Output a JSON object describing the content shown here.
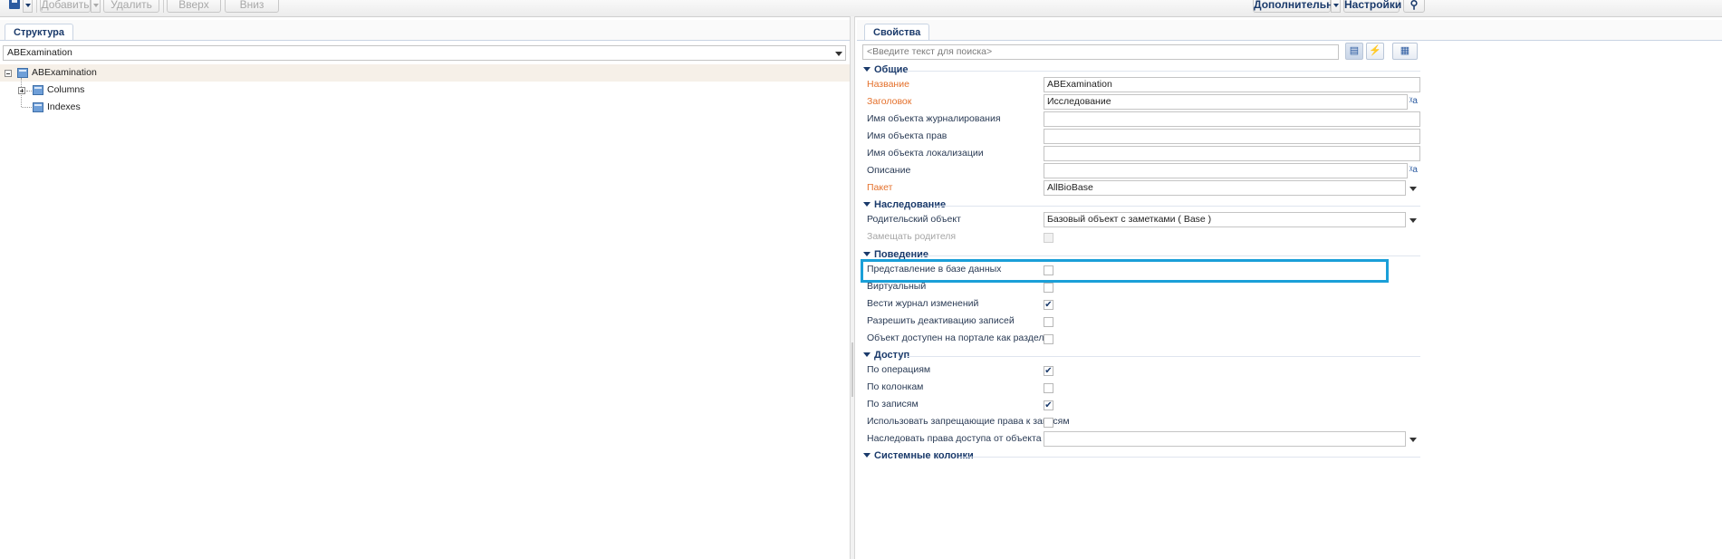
{
  "toolbar": {
    "add_label": "Добавить",
    "delete_label": "Удалить",
    "up_label": "Вверх",
    "down_label": "Вниз",
    "additional_label": "Дополнительно",
    "settings_label": "Настройки"
  },
  "structure": {
    "tab_label": "Структура",
    "object_select_value": "ABExamination",
    "tree": {
      "root": "ABExamination",
      "children": [
        "Columns",
        "Indexes"
      ]
    }
  },
  "properties": {
    "tab_label": "Свойства",
    "search_placeholder": "<Введите текст для поиска>",
    "groups": {
      "general": "Общие",
      "inheritance": "Наследование",
      "behavior": "Поведение",
      "access": "Доступ",
      "system_columns": "Системные колонки"
    },
    "general": {
      "name_label": "Название",
      "name_value": "ABExamination",
      "caption_label": "Заголовок",
      "caption_value": "Исследование",
      "log_object_label": "Имя объекта журналирования",
      "rights_object_label": "Имя объекта прав",
      "localization_object_label": "Имя объекта локализации",
      "description_label": "Описание",
      "package_label": "Пакет",
      "package_value": "AllBioBase"
    },
    "inheritance": {
      "parent_label": "Родительский объект",
      "parent_value": "Базовый объект с заметками ( Base )",
      "replace_parent_label": "Замещать родителя"
    },
    "behavior": {
      "db_view_label": "Представление в базе данных",
      "virtual_label": "Виртуальный",
      "change_log_label": "Вести журнал изменений",
      "allow_deactivation_label": "Разрешить деактивацию записей",
      "portal_section_label": "Объект доступен на портале как раздел"
    },
    "access": {
      "by_operations_label": "По операциям",
      "by_columns_label": "По колонкам",
      "by_records_label": "По записям",
      "deny_rights_label": "Использовать запрещающие права к записям",
      "inherit_rights_label": "Наследовать права доступа от объекта"
    },
    "checkboxes": {
      "db_view": false,
      "virtual": false,
      "change_log": true,
      "allow_deactivation": false,
      "portal_section": false,
      "replace_parent": false,
      "by_operations": true,
      "by_columns": false,
      "by_records": true,
      "deny_rights": false
    },
    "check_glyph": "✔",
    "lang_glyph": "ᵡa"
  },
  "colors": {
    "accent": "#1a3a6b",
    "required_label": "#e4702b",
    "highlight_box": "#1a9fd8"
  }
}
